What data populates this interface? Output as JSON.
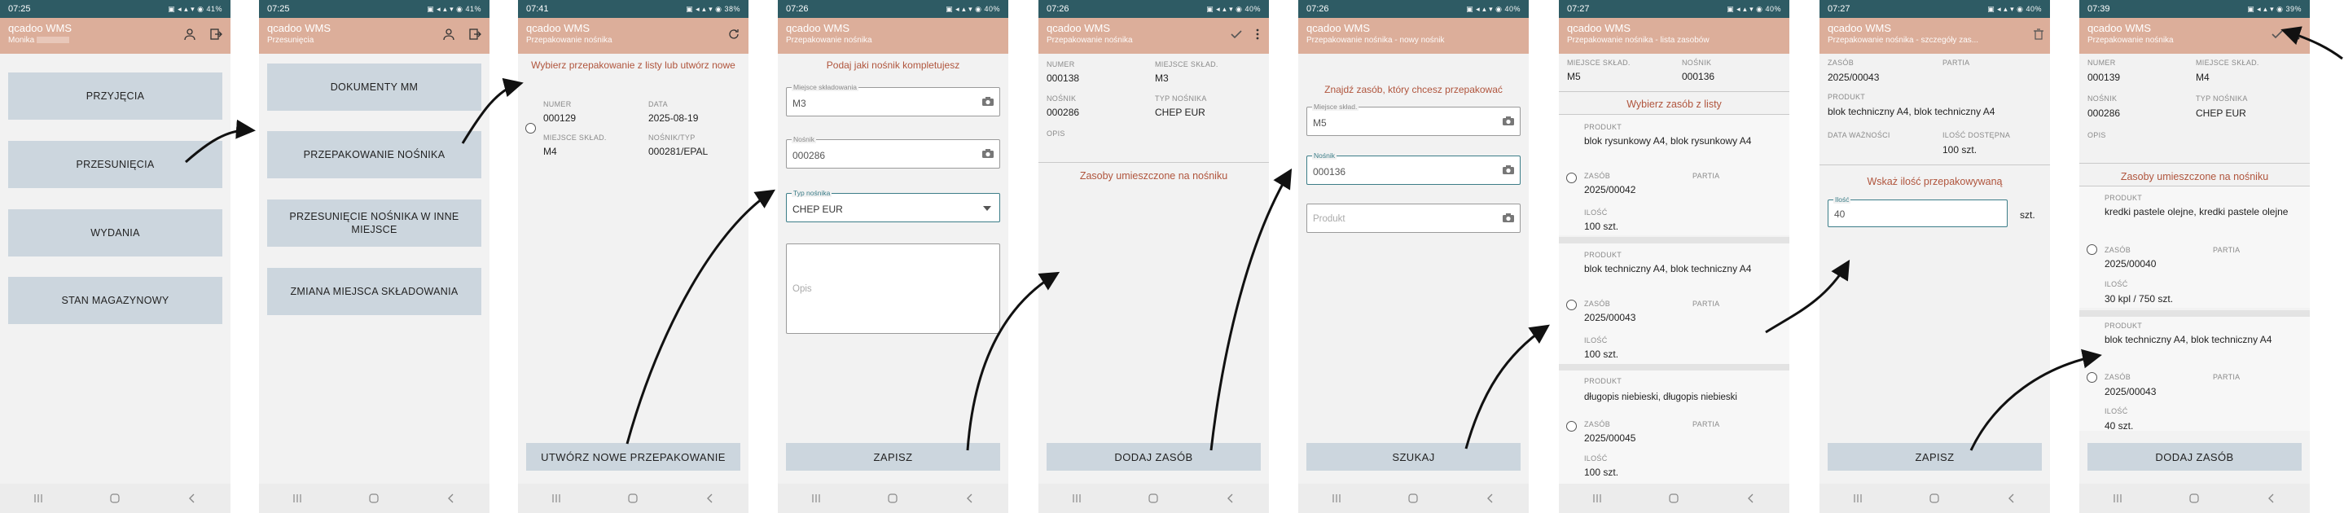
{
  "screens": [
    {
      "status_time": "07:25",
      "battery": "41%",
      "app_title": "qcadoo WMS",
      "app_subtitle": "Monika",
      "menu": [
        "PRZYJĘCIA",
        "PRZESUNIĘCIA",
        "WYDANIA",
        "STAN MAGAZYNOWY"
      ]
    },
    {
      "status_time": "07:25",
      "battery": "41%",
      "app_title": "qcadoo WMS",
      "app_subtitle": "Przesunięcia",
      "menu": [
        "DOKUMENTY MM",
        "PRZEPAKOWANIE NOŚNIKA",
        "PRZESUNIĘCIE NOŚNIKA W INNE MIEJSCE",
        "ZMIANA MIEJSCA SKŁADOWANIA"
      ]
    },
    {
      "status_time": "07:41",
      "battery": "38%",
      "app_title": "qcadoo WMS",
      "app_subtitle": "Przepakowanie nośnika",
      "message": "Wybierz przepakowanie z listy lub utwórz nowe",
      "labels": {
        "number": "NUMER",
        "date": "DATA",
        "location": "MIEJSCE SKŁAD.",
        "carrier_type": "NOŚNIK/TYP"
      },
      "item": {
        "number": "000129",
        "date": "2025-08-19",
        "location": "M4",
        "carrier_type": "000281/EPAL"
      },
      "button": "UTWÓRZ NOWE PRZEPAKOWANIE"
    },
    {
      "status_time": "07:26",
      "battery": "40%",
      "app_title": "qcadoo WMS",
      "app_subtitle": "Przepakowanie nośnika",
      "message": "Podaj jaki nośnik kompletujesz",
      "fields": {
        "location_label": "Miejsce składowania",
        "location_value": "M3",
        "carrier_label": "Nośnik",
        "carrier_value": "000286",
        "type_label": "Typ nośnika",
        "type_value": "CHEP EUR",
        "notes_placeholder": "Opis"
      },
      "button": "ZAPISZ"
    },
    {
      "status_time": "07:26",
      "battery": "40%",
      "app_title": "qcadoo WMS",
      "app_subtitle": "Przepakowanie nośnika",
      "labels": {
        "number": "NUMER",
        "location": "MIEJSCE SKŁAD.",
        "carrier": "NOŚNIK",
        "carrier_type": "TYP NOŚNIKA",
        "notes": "OPIS"
      },
      "values": {
        "number": "000138",
        "location": "M3",
        "carrier": "000286",
        "carrier_type": "CHEP EUR"
      },
      "section": "Zasoby umieszczone na nośniku",
      "button": "DODAJ ZASÓB"
    },
    {
      "status_time": "07:26",
      "battery": "40%",
      "app_title": "qcadoo WMS",
      "app_subtitle": "Przepakowanie nośnika - nowy nośnik",
      "message": "Znajdź zasób, który chcesz przepakować",
      "fields": {
        "location_label": "Miejsce skład.",
        "location_value": "M5",
        "carrier_label": "Nośnik",
        "carrier_value": "000136",
        "product_placeholder": "Produkt"
      },
      "button": "SZUKAJ"
    },
    {
      "status_time": "07:27",
      "battery": "40%",
      "app_title": "qcadoo WMS",
      "app_subtitle": "Przepakowanie nośnika - lista zasobów",
      "labels": {
        "location": "MIEJSCE SKŁAD.",
        "carrier": "NOŚNIK",
        "product": "PRODUKT",
        "resource": "ZASÓB",
        "batch": "PARTIA",
        "qty": "ILOŚĆ"
      },
      "values": {
        "location": "M5",
        "carrier": "000136"
      },
      "section": "Wybierz zasób z listy",
      "items": [
        {
          "product": "blok rysunkowy A4, blok rysunkowy A4",
          "resource": "2025/00042",
          "qty": "100 szt."
        },
        {
          "product": "blok techniczny A4, blok techniczny A4",
          "resource": "2025/00043",
          "qty": "100 szt."
        },
        {
          "product": "długopis niebieski, długopis niebieski",
          "resource": "2025/00045",
          "qty": "100 szt."
        }
      ]
    },
    {
      "status_time": "07:27",
      "battery": "40%",
      "app_title": "qcadoo WMS",
      "app_subtitle": "Przepakowanie nośnika - szczegóły zas...",
      "labels": {
        "resource": "ZASÓB",
        "batch": "PARTIA",
        "product": "PRODUKT",
        "expiry": "DATA WAŻNOŚCI",
        "available_qty": "ILOŚĆ DOSTĘPNA"
      },
      "values": {
        "resource": "2025/00043",
        "product": "blok techniczny A4, blok techniczny A4",
        "available_qty": "100 szt."
      },
      "section": "Wskaż ilość przepakowywaną",
      "qty_label": "Ilość",
      "qty_value": "40",
      "unit": "szt.",
      "button": "ZAPISZ"
    },
    {
      "status_time": "07:39",
      "battery": "39%",
      "app_title": "qcadoo WMS",
      "app_subtitle": "Przepakowanie nośnika",
      "labels": {
        "number": "NUMER",
        "location": "MIEJSCE SKŁAD.",
        "carrier": "NOŚNIK",
        "carrier_type": "TYP NOŚNIKA",
        "notes": "OPIS",
        "product": "PRODUKT",
        "resource": "ZASÓB",
        "batch": "PARTIA",
        "qty": "ILOŚĆ"
      },
      "values": {
        "number": "000139",
        "location": "M4",
        "carrier": "000286",
        "carrier_type": "CHEP EUR"
      },
      "section": "Zasoby umieszczone na nośniku",
      "items": [
        {
          "product": "kredki pastele olejne, kredki pastele olejne",
          "resource": "2025/00040",
          "qty": "30 kpl / 750 szt."
        },
        {
          "product": "blok techniczny A4, blok techniczny A4",
          "resource": "2025/00043",
          "qty": "40 szt."
        }
      ],
      "button": "DODAJ ZASÓB"
    }
  ]
}
